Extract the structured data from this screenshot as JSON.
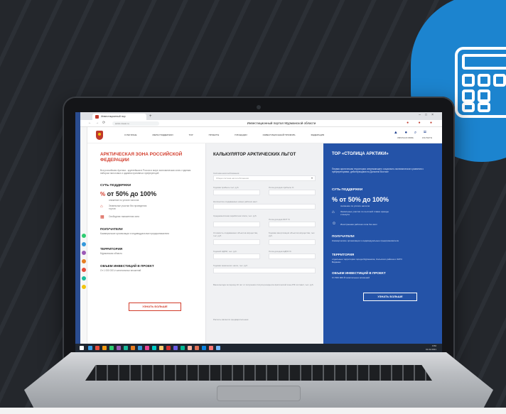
{
  "browser": {
    "tab_title": "Инвестиционный пор",
    "url_text": "arctic-invest.ru",
    "page_title": "Инвестиционный портал Мурманской области"
  },
  "site": {
    "menu": [
      "О РЕГИОНЕ",
      "МЕРЫ ПОДДЕРЖКИ",
      "ТОР",
      "ПРОЕКТЫ",
      "ПЛОЩАДКИ",
      "ИНВЕСТИЦИОННЫЙ ПРОФИЛЬ",
      "ФЕДЕРАЦИЯ"
    ],
    "header_sub": [
      "ОБРАТНАЯ СВЯЗЬ",
      "КОНТАКТЫ"
    ]
  },
  "left": {
    "title": "АРКТИЧЕСКАЯ ЗОНА РОССИЙСКОЙ ФЕДЕРАЦИИ",
    "description": "Вся российская Арктика - крупнейшая в России и мире экономическая зона с единым набором налоговых и административных преференций",
    "support_head": "СУТЬ ПОДДЕРЖКИ",
    "support_big": "от 50% до 100%",
    "support_note": "снижение по уплате налогов",
    "item_land": "Земельные участки без проведения торгов",
    "item_customs": "Свободная таможенная зона",
    "recipients_head": "ПОЛУЧАТЕЛИ",
    "recipients_text": "Коммерческие организации и индивидуальные предприниматели",
    "territory_head": "ТЕРРИТОРИЯ",
    "territory_text": "Мурманская область",
    "invest_head": "ОБЪЕМ ИНВЕСТИЦИЙ В ПРОЕКТ",
    "invest_text": "От 1 000 000 ₽ капитальных вложений",
    "button": "УЗНАТЬ БОЛЬШЕ"
  },
  "calculator": {
    "title": "КАЛЬКУЛЯТОР АРКТИЧЕСКИХ ЛЬГОТ",
    "system_label": "Система налогообложения",
    "system_value": "Общая система налогообложения",
    "fields": [
      "Годовая прибыль тыс. руб.",
      "Лоток доходов прибыль %",
      "Количество создаваемых новых рабочих мест",
      "Среднемесячная заработная плата, тыс. руб.",
      "Лоток доходов ФОТ %",
      "Стоимость создаваемых объектов имущества, тыс. руб.",
      "Годовая амортизация объектов имущества, тыс. руб.",
      "Годовой НДПИ, тыс. руб.",
      "Лоток доходов НДПИ %",
      "Годовая земельного налог, тыс. руб."
    ],
    "result_label": "Ваша выгода за период 10 лет от получения статуса резидента Арктической зоны РФ составит, тыс. руб.",
    "footer_note": "Расчеты является предварительным"
  },
  "right": {
    "title": "ТОР «СТОЛИЦА АРКТИКИ»",
    "description": "Первая арктическая территория опережающего социально-экономического развития с преференциями, действующими на Дальнем Востоке",
    "support_head": "СУТЬ ПОДДЕРЖКИ",
    "support_big": "от 50% до 100%",
    "support_note": "снижение по уплате налогов",
    "item_land": "Земельные участки по льготной ставке аренды и выкупа",
    "item_jobs": "Иностранная рабочая сила без квот",
    "recipients_head": "ПОЛУЧАТЕЛИ",
    "recipients_text": "Коммерческие организации и индивидуальные предприниматели",
    "territory_head": "ТЕРРИТОРИЯ",
    "territory_text": "отдельные территории города Мурманска, Кольского района и ЗАТО Видяево",
    "invest_head": "ОБЪЕМ ИНВЕСТИЦИЙ В ПРОЕКТ",
    "invest_text": "От 500 000 ₽ капитальных вложений",
    "button": "УЗНАТЬ БОЛЬШЕ"
  },
  "taskbar": {
    "time": "9:50",
    "date": "01.02.2021"
  },
  "colors": {
    "accent_red": "#d23b2a",
    "accent_blue": "#2453a8",
    "badge_blue": "#1c84cf"
  }
}
